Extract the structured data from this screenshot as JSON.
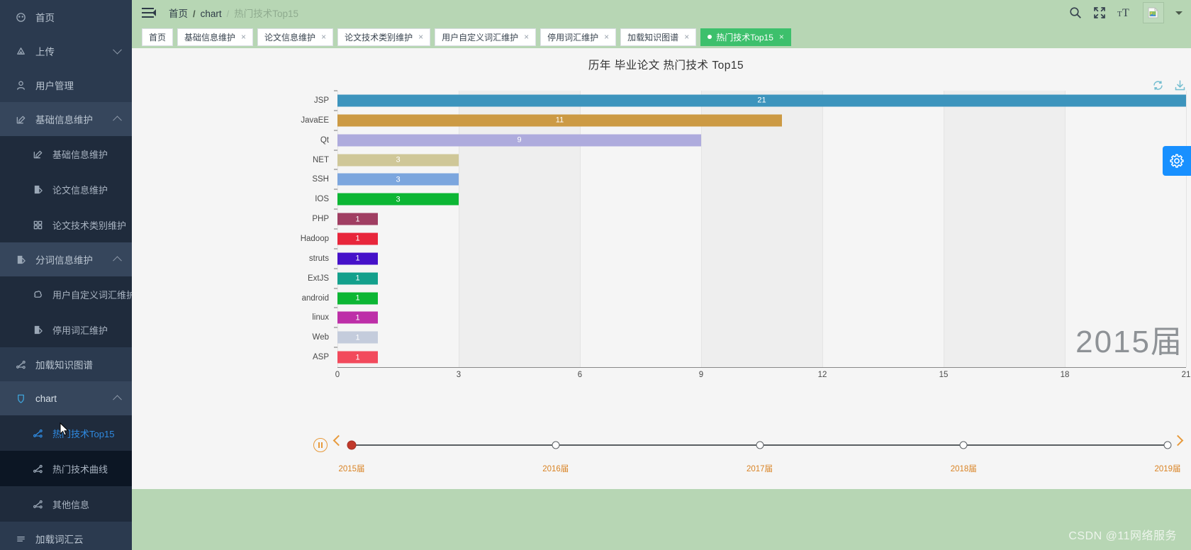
{
  "sidebar": {
    "items": [
      {
        "label": "首页",
        "icon": "dashboard-icon",
        "level": 1,
        "state": "normal",
        "caret": "none"
      },
      {
        "label": "上传",
        "icon": "upload-icon",
        "level": 1,
        "state": "normal",
        "caret": "down"
      },
      {
        "label": "用户管理",
        "icon": "user-icon",
        "level": 1,
        "state": "normal",
        "caret": "none"
      },
      {
        "label": "基础信息维护",
        "icon": "edit-icon",
        "level": 1,
        "state": "open",
        "caret": "up"
      },
      {
        "label": "基础信息维护",
        "icon": "edit-icon",
        "level": 2,
        "state": "normal",
        "caret": "none"
      },
      {
        "label": "论文信息维护",
        "icon": "doc-icon",
        "level": 2,
        "state": "normal",
        "caret": "none"
      },
      {
        "label": "论文技术类别维护",
        "icon": "grid-icon",
        "level": 2,
        "state": "normal",
        "caret": "none"
      },
      {
        "label": "分词信息维护",
        "icon": "doc-icon",
        "level": 1,
        "state": "open",
        "caret": "up"
      },
      {
        "label": "用户自定义词汇维护",
        "icon": "share-icon",
        "level": 2,
        "state": "normal",
        "caret": "none"
      },
      {
        "label": "停用词汇维护",
        "icon": "doc-icon",
        "level": 2,
        "state": "normal",
        "caret": "none"
      },
      {
        "label": "加载知识图谱",
        "icon": "graph-icon",
        "level": 1,
        "state": "normal",
        "caret": "none"
      },
      {
        "label": "chart",
        "icon": "chart-icon",
        "level": 1,
        "state": "chart-open",
        "caret": "up"
      },
      {
        "label": "热门技术Top15",
        "icon": "graph-icon",
        "level": 2,
        "state": "active",
        "caret": "none"
      },
      {
        "label": "热门技术曲线",
        "icon": "graph-icon",
        "level": 2,
        "state": "hovered",
        "caret": "none"
      },
      {
        "label": "其他信息",
        "icon": "graph-icon",
        "level": 2,
        "state": "normal",
        "caret": "none"
      },
      {
        "label": "加载词汇云",
        "icon": "cloud-icon",
        "level": 1,
        "state": "normal",
        "caret": "none"
      }
    ]
  },
  "header": {
    "menu_icon": "hamburger-icon",
    "breadcrumb": [
      {
        "label": "首页",
        "muted": false
      },
      {
        "label": "chart",
        "muted": false
      },
      {
        "label": "热门技术Top15",
        "muted": true
      }
    ],
    "actions": [
      {
        "name": "search-icon"
      },
      {
        "name": "fullscreen-icon"
      },
      {
        "name": "text-size-icon"
      },
      {
        "name": "avatar"
      },
      {
        "name": "chevron-down-icon"
      }
    ]
  },
  "tabs": [
    {
      "label": "首页",
      "closable": false,
      "active": false
    },
    {
      "label": "基础信息维护",
      "closable": true,
      "active": false
    },
    {
      "label": "论文信息维护",
      "closable": true,
      "active": false
    },
    {
      "label": "论文技术类别维护",
      "closable": true,
      "active": false
    },
    {
      "label": "用户自定义词汇维护",
      "closable": true,
      "active": false
    },
    {
      "label": "停用词汇维护",
      "closable": true,
      "active": false
    },
    {
      "label": "加载知识图谱",
      "closable": true,
      "active": false
    },
    {
      "label": "热门技术Top15",
      "closable": true,
      "active": true
    }
  ],
  "chart_tools": [
    {
      "name": "refresh-icon"
    },
    {
      "name": "download-icon"
    }
  ],
  "fab": {
    "name": "gear-icon",
    "color": "#1890ff"
  },
  "watermark": "CSDN @11网络服务",
  "timeline": {
    "play_state": "pause",
    "current_index": 0,
    "nodes": [
      "2015届",
      "2016届",
      "2017届",
      "2018届",
      "2019届"
    ],
    "prev_label": "prev-year",
    "next_label": "next-year"
  },
  "chart_data": {
    "type": "bar",
    "orientation": "horizontal",
    "title": "历年 毕业论文 热门技术 Top15",
    "xlabel": "",
    "ylabel": "",
    "xlim": [
      0,
      21
    ],
    "xticks": [
      0,
      3,
      6,
      9,
      12,
      15,
      18,
      21
    ],
    "grid": true,
    "legend": false,
    "annotation": "2015届",
    "categories": [
      "JSP",
      "JavaEE",
      "Qt",
      "NET",
      "SSH",
      "IOS",
      "PHP",
      "Hadoop",
      "struts",
      "ExtJS",
      "android",
      "linux",
      "Web",
      "ASP"
    ],
    "values": [
      21,
      11,
      9,
      3,
      3,
      3,
      1,
      1,
      1,
      1,
      1,
      1,
      1,
      1
    ],
    "colors": [
      "#3d94bd",
      "#cc9a44",
      "#aeabdd",
      "#cfc798",
      "#7ca6de",
      "#0cb634",
      "#a03e62",
      "#e8263b",
      "#4511c9",
      "#13a08c",
      "#0cb634",
      "#bd2fa8",
      "#c4ccdc",
      "#f24a5c"
    ]
  }
}
